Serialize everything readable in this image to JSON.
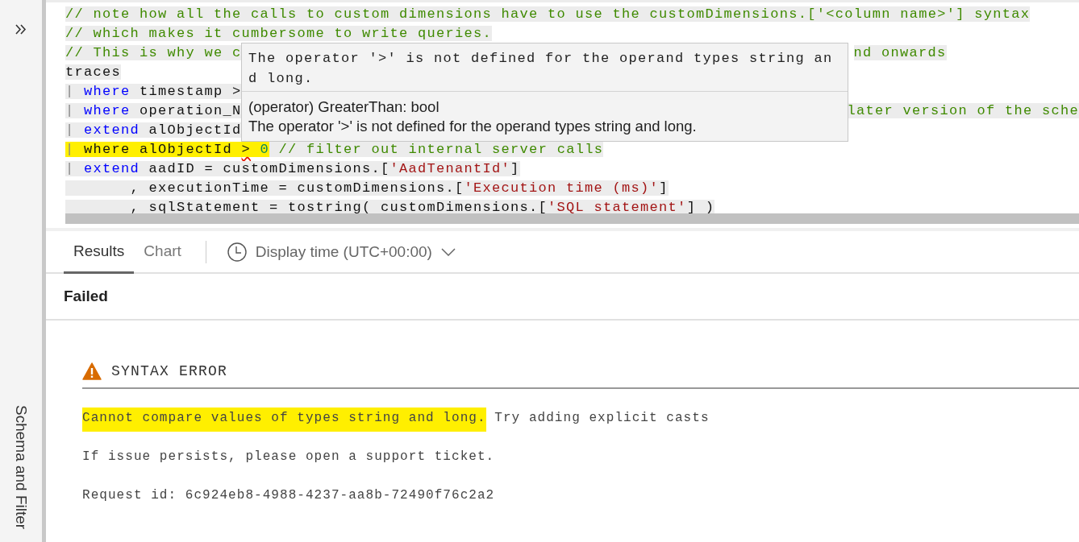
{
  "sidebar": {
    "title": "Schema and Filter"
  },
  "editor": {
    "lines": [
      {
        "highlighted": false,
        "tokens": [
          {
            "kind": "comment",
            "text": "// note how all the calls to custom dimensions have to use the customDimensions.['<column name>'] syntax"
          }
        ]
      },
      {
        "highlighted": false,
        "tokens": [
          {
            "kind": "comment",
            "text": "// which makes it cumbersome to write queries."
          }
        ]
      },
      {
        "highlighted": false,
        "tokens": [
          {
            "kind": "comment",
            "text": "// This is why we c"
          }
        ],
        "tokens_after_popup": [
          {
            "kind": "comment",
            "text": "nd onwards"
          }
        ]
      },
      {
        "highlighted": false,
        "tokens": [
          {
            "kind": "plain",
            "text": "traces"
          }
        ]
      },
      {
        "highlighted": false,
        "tokens": [
          {
            "kind": "pipe",
            "text": "| "
          },
          {
            "kind": "keyword",
            "text": "where"
          },
          {
            "kind": "plain",
            "text": " timestamp >"
          }
        ]
      },
      {
        "highlighted": false,
        "tokens": [
          {
            "kind": "pipe",
            "text": "| "
          },
          {
            "kind": "keyword",
            "text": "where"
          },
          {
            "kind": "plain",
            "text": " operation_N"
          }
        ],
        "tokens_after_popup": [
          {
            "kind": "comment",
            "text": "later version of the sche"
          }
        ]
      },
      {
        "highlighted": false,
        "tokens": [
          {
            "kind": "pipe",
            "text": "| "
          },
          {
            "kind": "keyword",
            "text": "extend"
          },
          {
            "kind": "plain",
            "text": " alObjectId"
          }
        ]
      },
      {
        "highlighted": true,
        "tokens": [
          {
            "kind": "pipe",
            "text": "| "
          },
          {
            "kind": "plain",
            "text": "where alObjectId "
          },
          {
            "kind": "error",
            "text": ">"
          },
          {
            "kind": "number",
            "text": " 0"
          },
          {
            "kind": "comment",
            "text": " // filter out internal server calls"
          }
        ]
      },
      {
        "highlighted": false,
        "tokens": [
          {
            "kind": "pipe",
            "text": "| "
          },
          {
            "kind": "keyword",
            "text": "extend"
          },
          {
            "kind": "plain",
            "text": " aadID = customDimensions.["
          },
          {
            "kind": "string",
            "text": "'AadTenantId'"
          },
          {
            "kind": "plain",
            "text": "]"
          }
        ]
      },
      {
        "highlighted": false,
        "tokens": [
          {
            "kind": "plain",
            "text": "       , executionTime = customDimensions.["
          },
          {
            "kind": "string",
            "text": "'Execution time (ms)'"
          },
          {
            "kind": "plain",
            "text": "]"
          }
        ]
      },
      {
        "highlighted": false,
        "tokens": [
          {
            "kind": "plain",
            "text": "       , sqlStatement = tostring( customDimensions.["
          },
          {
            "kind": "string",
            "text": "'SQL statement'"
          },
          {
            "kind": "plain",
            "text": "] )"
          }
        ]
      }
    ]
  },
  "popup": {
    "error": "The operator '>' is not defined for the operand types string and long.",
    "signature": "(operator) GreaterThan: bool",
    "description": "The operator '>' is not defined for the operand types string and long."
  },
  "tabs": [
    {
      "label": "Results",
      "selected": true
    },
    {
      "label": "Chart",
      "selected": false
    }
  ],
  "time_selector": {
    "label": "Display time (UTC+00:00)"
  },
  "status": "Failed",
  "error": {
    "title": "SYNTAX ERROR",
    "messages": [
      {
        "parts": [
          {
            "text": "Cannot compare values of types string and long.",
            "highlighted": true
          },
          {
            "text": " Try adding explicit casts",
            "highlighted": false
          }
        ]
      },
      {
        "parts": [
          {
            "text": "If issue persists, please open a support ticket.",
            "highlighted": false
          }
        ]
      },
      {
        "parts": [
          {
            "text": "Request id: 6c924eb8-4988-4237-aa8b-72490f76c2a2",
            "highlighted": false
          }
        ]
      }
    ]
  }
}
